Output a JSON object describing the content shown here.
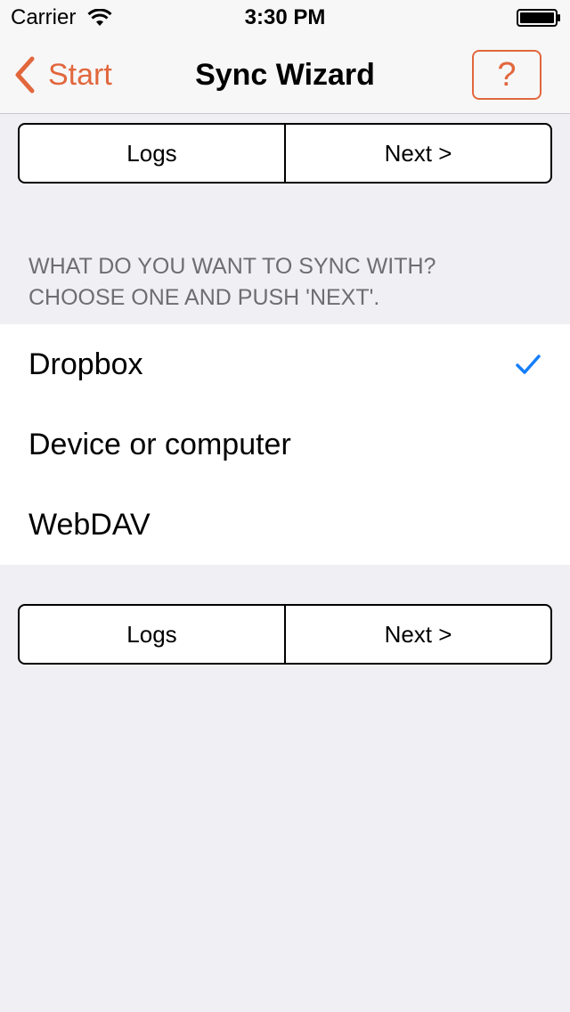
{
  "status_bar": {
    "carrier": "Carrier",
    "time": "3:30 PM"
  },
  "nav": {
    "back_label": "Start",
    "title": "Sync Wizard",
    "help_label": "?"
  },
  "top_buttons": {
    "logs": "Logs",
    "next": "Next >"
  },
  "section": {
    "line1": "WHAT DO YOU WANT TO SYNC WITH?",
    "line2": "CHOOSE ONE AND PUSH 'NEXT'."
  },
  "options": [
    {
      "label": "Dropbox",
      "selected": true
    },
    {
      "label": "Device or computer",
      "selected": false
    },
    {
      "label": "WebDAV",
      "selected": false
    }
  ],
  "bottom_buttons": {
    "logs": "Logs",
    "next": "Next >"
  },
  "colors": {
    "accent": "#e2673d",
    "check": "#157efb",
    "background": "#efeff4"
  }
}
